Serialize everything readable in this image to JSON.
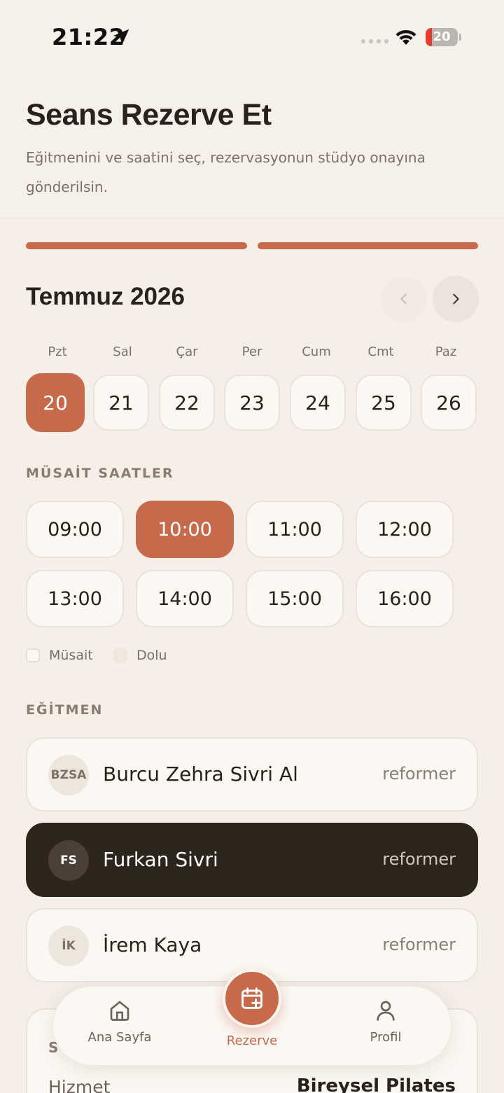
{
  "status_bar": {
    "time": "21:22",
    "battery_level": "20",
    "battery_fraction": 0.2
  },
  "header": {
    "title": "Seans Rezerve Et",
    "subtitle": "Eğitmenini ve saatini seç, rezervasyonun stüdyo onayına gönderilsin."
  },
  "progress": {
    "steps_total": 2,
    "steps_done": 2,
    "color": "#c76a4c"
  },
  "calendar": {
    "month": "Temmuz 2026",
    "weekdays": [
      "Pzt",
      "Sal",
      "Çar",
      "Per",
      "Cum",
      "Cmt",
      "Paz"
    ],
    "days": [
      "20",
      "21",
      "22",
      "23",
      "24",
      "25",
      "26"
    ],
    "selected_day": "20"
  },
  "times": {
    "label": "MÜSAİT SAATLER",
    "slots": [
      "09:00",
      "10:00",
      "11:00",
      "12:00",
      "13:00",
      "14:00",
      "15:00",
      "16:00"
    ],
    "selected": "10:00",
    "legend_available": "Müsait",
    "legend_full": "Dolu"
  },
  "trainers": {
    "label": "EĞİTMEN",
    "items": [
      {
        "initials": "BZSA",
        "name": "Burcu Zehra Sivri Al",
        "type": "reformer",
        "selected": false
      },
      {
        "initials": "FS",
        "name": "Furkan Sivri",
        "type": "reformer",
        "selected": true
      },
      {
        "initials": "İK",
        "name": "İrem Kaya",
        "type": "reformer",
        "selected": false
      }
    ]
  },
  "summary": {
    "label_letter": "S",
    "row_key": "Hizmet",
    "row_value": "Bireysel Pilates"
  },
  "bottom_nav": {
    "home": "Ana Sayfa",
    "reserve": "Rezerve",
    "profile": "Profil"
  },
  "colors": {
    "accent": "#c76a4c",
    "dark": "#2d241c",
    "background": "#f5efe8"
  }
}
